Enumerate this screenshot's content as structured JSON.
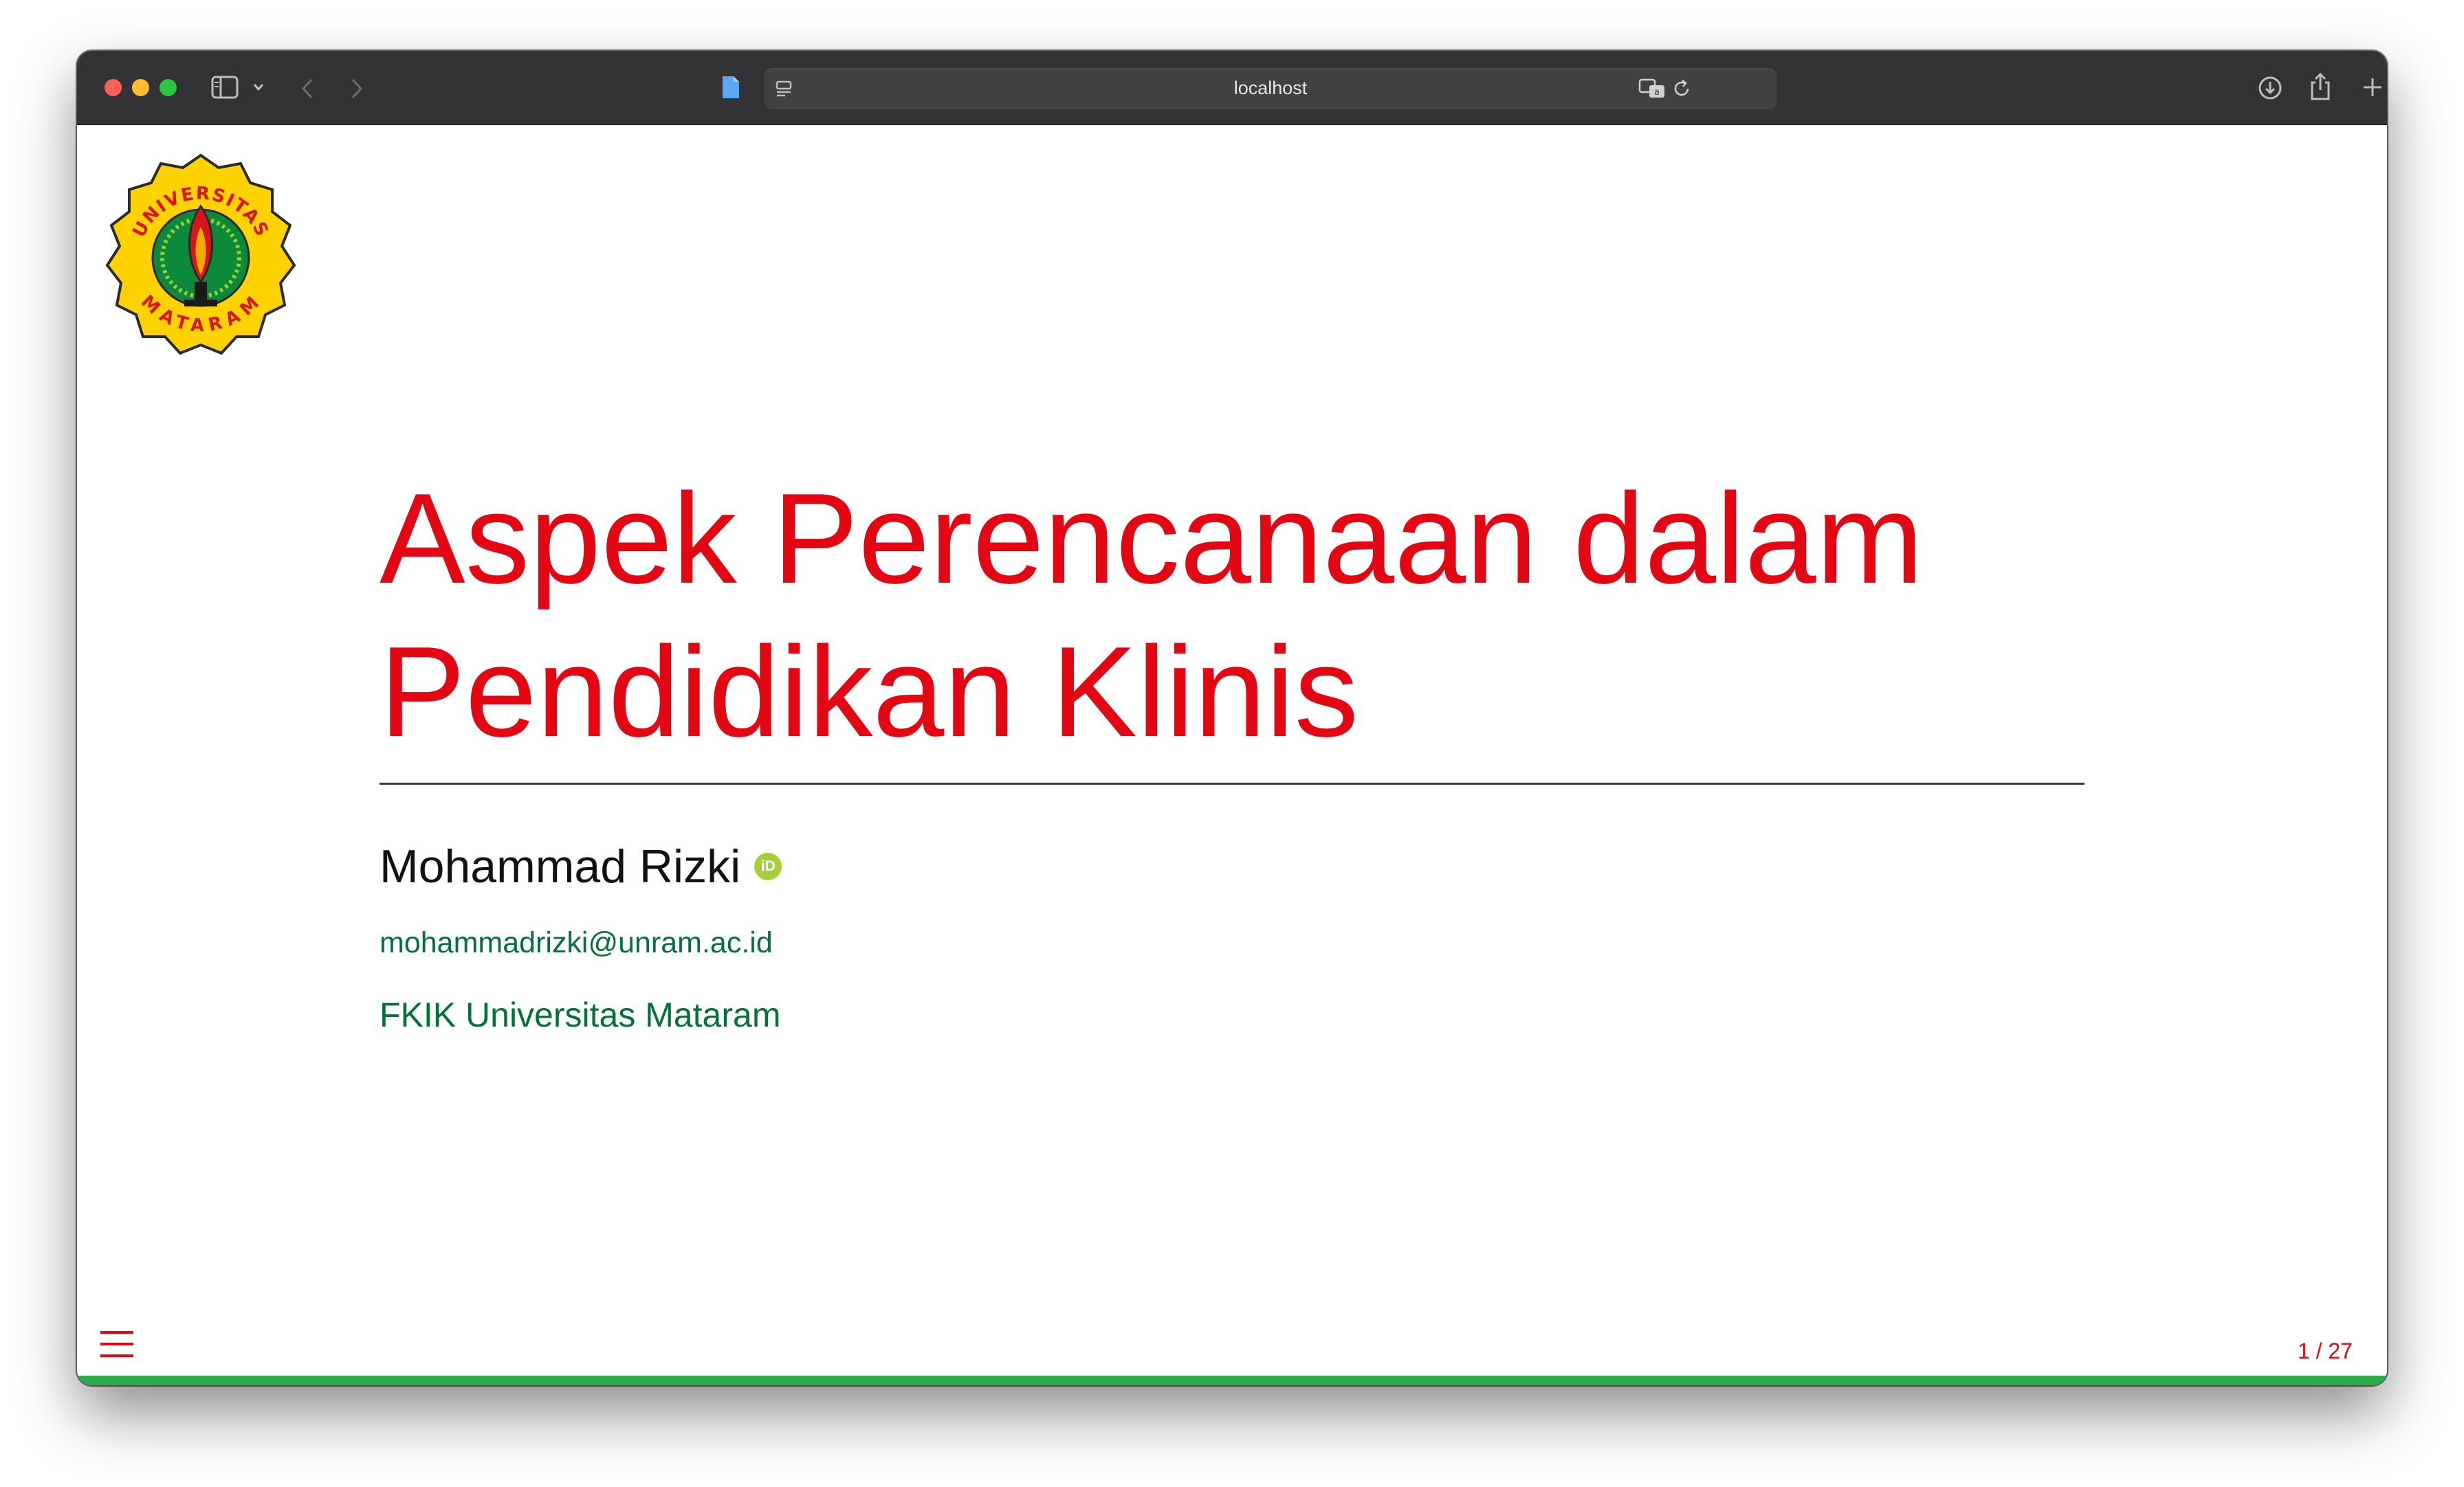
{
  "browser": {
    "url": "localhost"
  },
  "slide": {
    "logo_text_top": "UNIVERSITAS",
    "logo_text_bottom": "MATARAM",
    "title_line1": "Aspek Perencanaan dalam",
    "title_line2": "Pendidikan Klinis",
    "author": "Mohammad Rizki",
    "orcid_glyph": "iD",
    "email": "mohammadrizki@unram.ac.id",
    "affiliation": "FKIK Universitas Mataram",
    "slide_number": "1 / 27",
    "progress": 0.037
  },
  "colors": {
    "title": "#e30613",
    "accent_green": "#00723a",
    "progress": "#2eaa4a",
    "chrome": "#333335"
  }
}
